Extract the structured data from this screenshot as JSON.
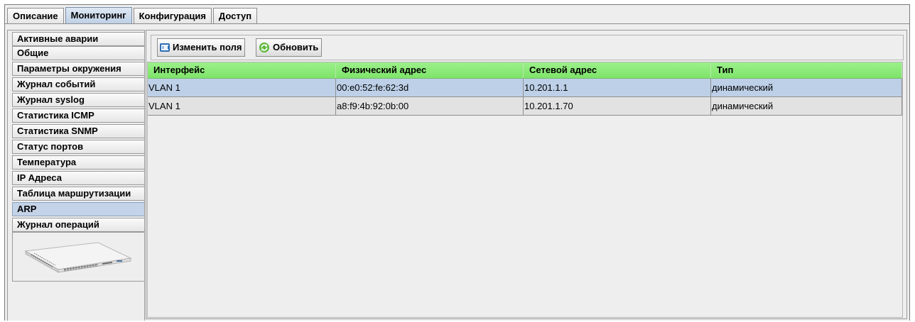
{
  "tabs": [
    {
      "label": "Описание",
      "active": false
    },
    {
      "label": "Мониторинг",
      "active": true
    },
    {
      "label": "Конфигурация",
      "active": false
    },
    {
      "label": "Доступ",
      "active": false
    }
  ],
  "sidebar": {
    "items": [
      {
        "label": "Активные аварии"
      },
      {
        "label": "Общие"
      },
      {
        "label": "Параметры окружения"
      },
      {
        "label": "Журнал событий"
      },
      {
        "label": "Журнал syslog"
      },
      {
        "label": "Статистика ICMP"
      },
      {
        "label": "Статистика SNMP"
      },
      {
        "label": "Статус портов"
      },
      {
        "label": "Температура"
      },
      {
        "label": "IP Адреса"
      },
      {
        "label": "Таблица маршрутизации"
      },
      {
        "label": "ARP",
        "active": true
      },
      {
        "label": "Журнал операций"
      }
    ]
  },
  "toolbar": {
    "edit_fields_label": "Изменить поля",
    "refresh_label": "Обновить"
  },
  "table": {
    "columns": [
      "Интерфейс",
      "Физический адрес",
      "Сетевой адрес",
      "Тип"
    ],
    "rows": [
      [
        "VLAN 1",
        "00:e0:52:fe:62:3d",
        "10.201.1.1",
        "динамический"
      ],
      [
        "VLAN 1",
        "a8:f9:4b:92:0b:00",
        "10.201.1.70",
        "динамический"
      ]
    ],
    "selected_row": 0
  },
  "colors": {
    "header_green": "#8aea76",
    "selected_row": "#bdd0e8",
    "active_tab": "#c4d3e7"
  }
}
